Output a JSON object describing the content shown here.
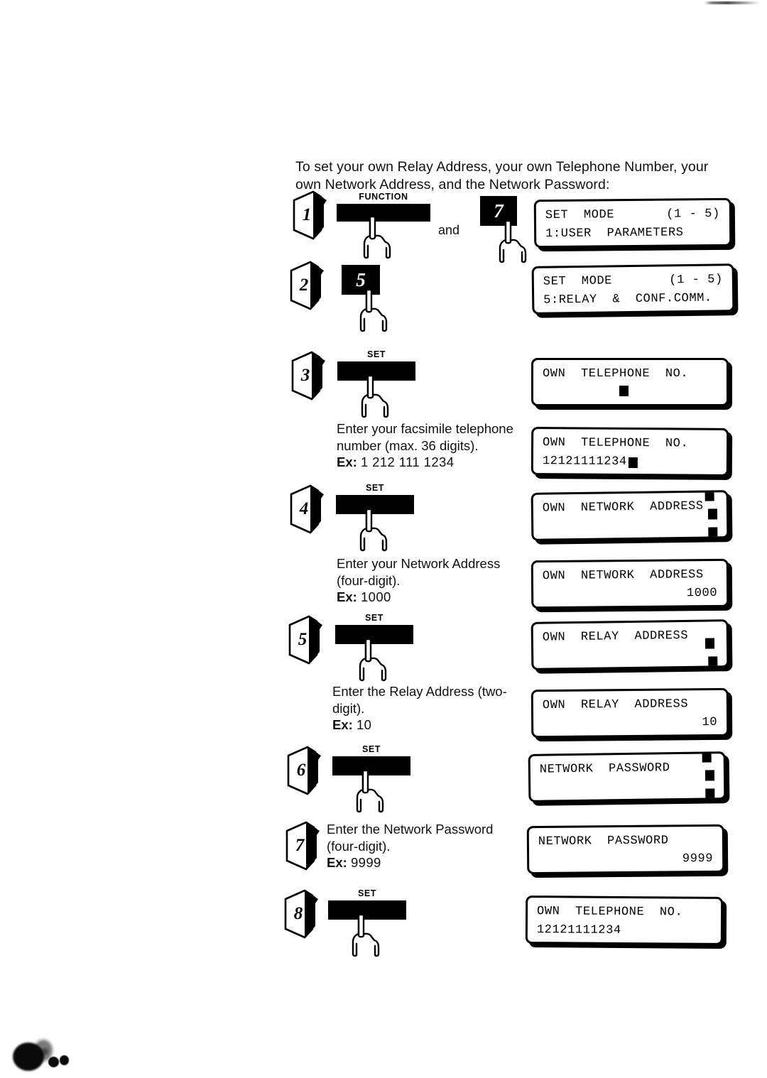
{
  "document": {
    "intro": "To set your own Relay Address, your own Telephone Number, your own Network Address, and the Network Password:",
    "conjunction": "and"
  },
  "steps": [
    {
      "number": "1",
      "key_label": "FUNCTION",
      "key_type": "wide",
      "second_key_digit": "7",
      "display": {
        "line1_left": "SET  MODE",
        "line1_right": "(1 - 5)",
        "line2_left": "1:USER  PARAMETERS",
        "line2_right": ""
      }
    },
    {
      "number": "2",
      "key_digit": "5",
      "key_type": "digit",
      "display": {
        "line1_left": "SET  MODE",
        "line1_right": "(1 - 5)",
        "line2_left": "5:RELAY  &  CONF.COMM.",
        "line2_right": ""
      }
    },
    {
      "number": "3",
      "key_label": "SET",
      "key_type": "wide",
      "display": {
        "line1_left": "OWN  TELEPHONE  NO.",
        "line1_right": "",
        "line2_left": "",
        "line2_right": "",
        "line2_cursors": 1,
        "cursors_align": "left"
      }
    },
    {
      "number": "",
      "key_type": "none",
      "instruction": {
        "text": "Enter your facsimile telephone number (max. 36 digits).",
        "ex_label": "Ex:",
        "ex_value": "1 212 111 1234"
      },
      "display": {
        "line1_left": "OWN  TELEPHONE  NO.",
        "line1_right": "",
        "line2_left": "12121111234",
        "line2_right": "",
        "line2_cursors": 1,
        "cursors_align": "inline"
      }
    },
    {
      "number": "4",
      "key_label": "SET",
      "key_type": "wide",
      "display": {
        "line1_left": "OWN  NETWORK  ADDRESS",
        "line1_right": "",
        "line2_left": "",
        "line2_right": "",
        "line2_cursors": 4,
        "cursors_align": "right"
      }
    },
    {
      "number": "",
      "key_type": "none",
      "instruction": {
        "text": "Enter your Network Address (four-digit).",
        "ex_label": "Ex:",
        "ex_value": "1000"
      },
      "display": {
        "line1_left": "OWN  NETWORK  ADDRESS",
        "line1_right": "",
        "line2_left": "",
        "line2_right": "1000"
      }
    },
    {
      "number": "5",
      "key_label": "SET",
      "key_type": "wide",
      "display": {
        "line1_left": "OWN  RELAY  ADDRESS",
        "line1_right": "",
        "line2_left": "",
        "line2_right": "",
        "line2_cursors": 2,
        "cursors_align": "right"
      }
    },
    {
      "number": "",
      "key_type": "none",
      "instruction": {
        "text": "Enter the Relay Address (two-digit).",
        "ex_label": "Ex:",
        "ex_value": "10"
      },
      "display": {
        "line1_left": "OWN  RELAY  ADDRESS",
        "line1_right": "",
        "line2_left": "",
        "line2_right": "10"
      }
    },
    {
      "number": "6",
      "key_label": "SET",
      "key_type": "wide",
      "display": {
        "line1_left": "NETWORK  PASSWORD",
        "line1_right": "",
        "line2_left": "",
        "line2_right": "",
        "line2_cursors": 4,
        "cursors_align": "right"
      }
    },
    {
      "number": "7",
      "key_type": "none",
      "instruction": {
        "text": "Enter the Network Password (four-digit).",
        "ex_label": "Ex:",
        "ex_value": "9999"
      },
      "display": {
        "line1_left": "NETWORK  PASSWORD",
        "line1_right": "",
        "line2_left": "",
        "line2_right": "9999"
      }
    },
    {
      "number": "8",
      "key_label": "SET",
      "key_type": "wide",
      "display": {
        "line1_left": "OWN  TELEPHONE  NO.",
        "line1_right": "",
        "line2_left": "12121111234",
        "line2_right": ""
      }
    }
  ]
}
